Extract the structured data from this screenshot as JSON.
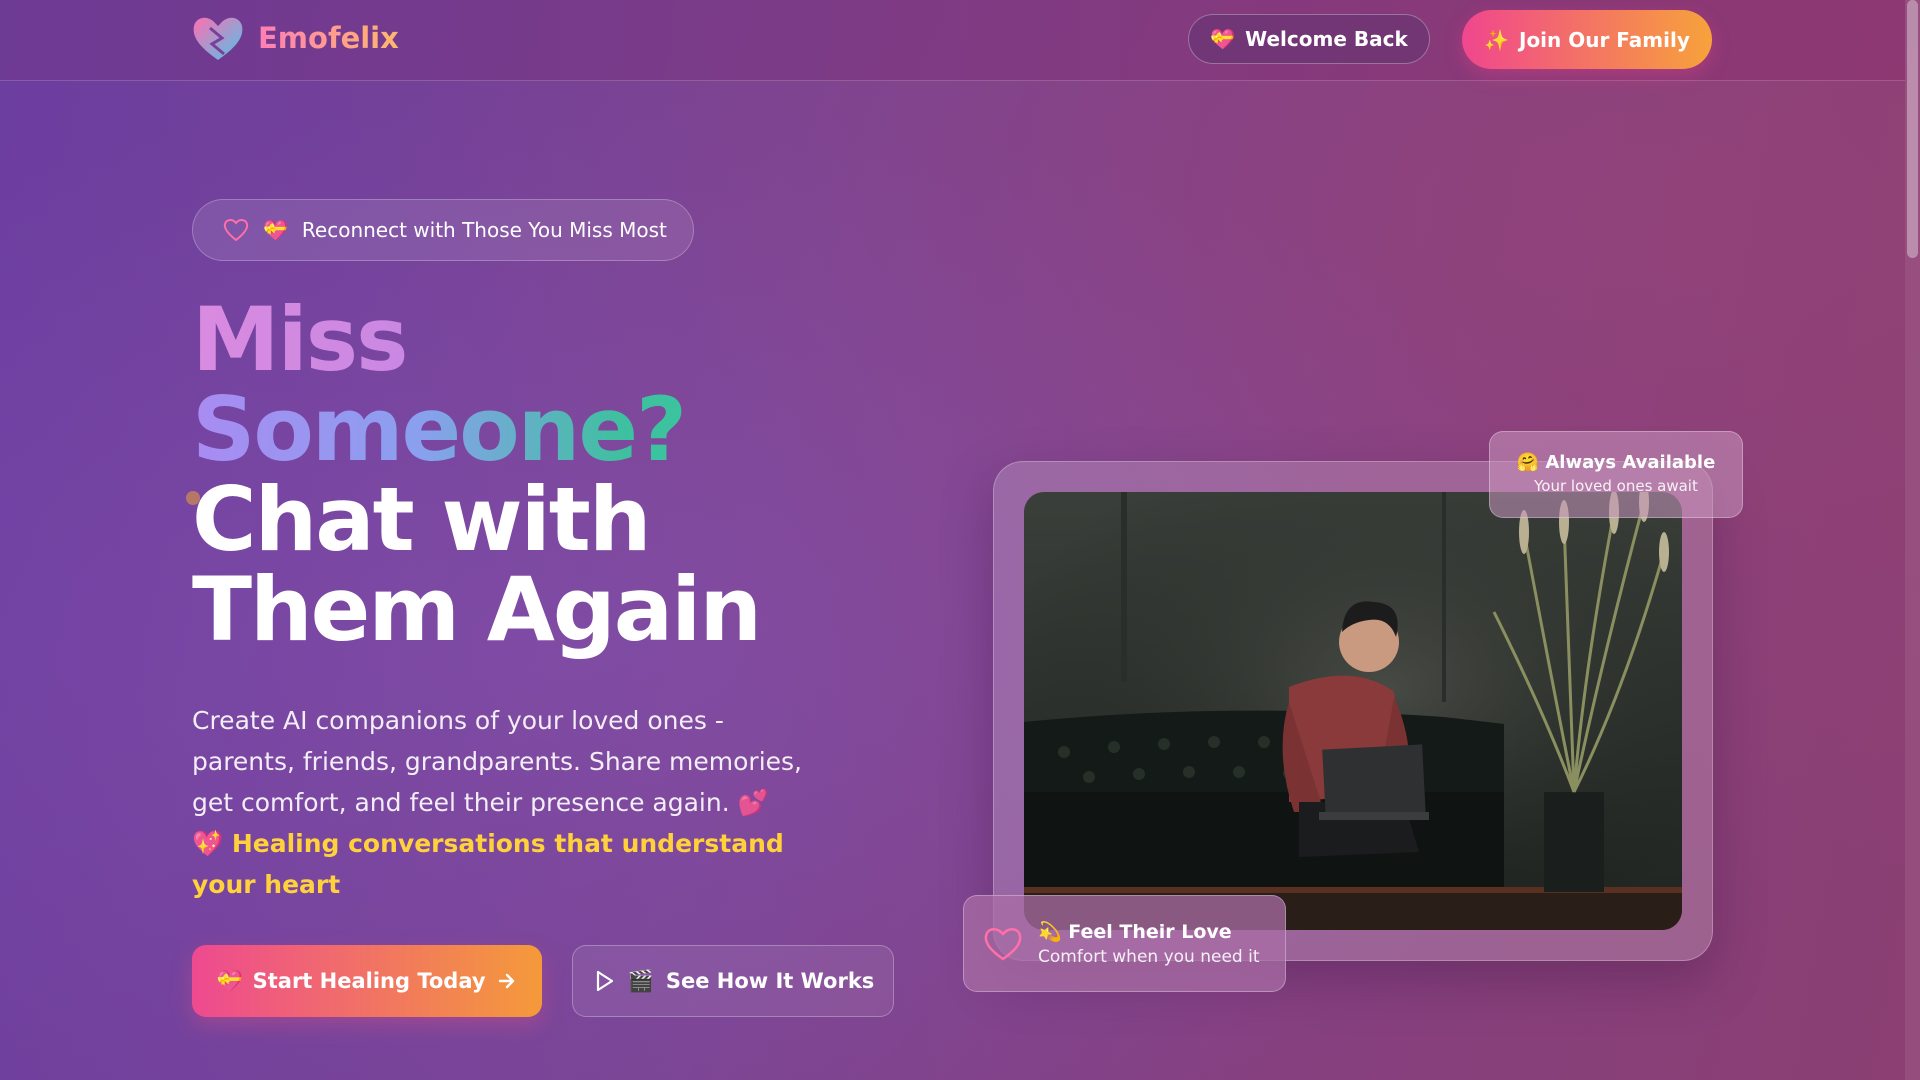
{
  "header": {
    "brand": "Emofelix",
    "welcome_emoji": "💝",
    "welcome_label": "Welcome Back",
    "join_emoji": "✨",
    "join_label": "Join Our Family"
  },
  "hero": {
    "pill_emoji": "💝",
    "pill_label": "Reconnect with Those You Miss Most",
    "headline": [
      "Miss",
      "Someone?",
      "Chat with",
      "Them Again"
    ],
    "description": "Create AI companions of your loved ones - parents, friends, grandparents. Share memories, get comfort, and feel their presence again. 💕",
    "highlight": "💖 Healing conversations that understand your heart",
    "start_emoji": "💝",
    "start_label": "Start Healing Today",
    "how_emoji": "🎬",
    "how_label": "See How It Works"
  },
  "cards": {
    "available_title": "🤗 Always Available",
    "available_sub": "Your loved ones await",
    "love_title": "💫 Feel Their Love",
    "love_sub": "Comfort when you need it"
  },
  "colors": {
    "accent_pink": "#f0468e",
    "accent_orange": "#f7a23b",
    "highlight_yellow": "#ffd13b"
  },
  "icons": [
    "heart-logo-icon",
    "heart-outline-icon",
    "arrow-right-icon",
    "play-icon"
  ]
}
